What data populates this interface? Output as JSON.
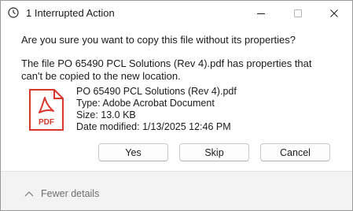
{
  "window": {
    "title": "1 Interrupted Action",
    "icon": "stopwatch-icon"
  },
  "dialog": {
    "question": "Are you sure you want to copy this file without its properties?",
    "message": "The file PO 65490 PCL Solutions (Rev 4).pdf has properties that can't be copied to the new location."
  },
  "file": {
    "icon": "pdf-file-icon",
    "icon_label": "PDF",
    "name": "PO 65490 PCL Solutions (Rev 4).pdf",
    "type": "Type: Adobe Acrobat Document",
    "size": "Size: 13.0 KB",
    "date_modified": "Date modified: 1/13/2025 12:46 PM"
  },
  "buttons": {
    "yes": "Yes",
    "skip": "Skip",
    "cancel": "Cancel"
  },
  "footer": {
    "details_toggle": "Fewer details"
  },
  "colors": {
    "pdf_red": "#d9372b",
    "footer_bg": "#f3f3f3",
    "muted_text": "#6d6d6d"
  }
}
